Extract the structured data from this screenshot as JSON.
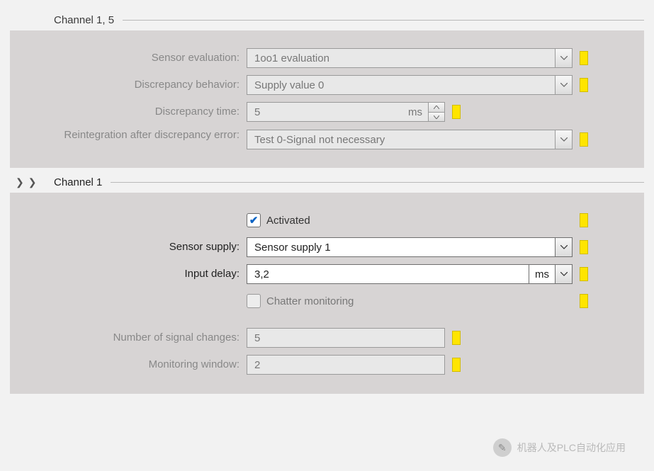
{
  "section1": {
    "title": "Channel 1, 5",
    "labels": {
      "sensor_eval": "Sensor evaluation:",
      "disc_behavior": "Discrepancy behavior:",
      "disc_time": "Discrepancy time:",
      "reint": "Reintegration after discrepancy error:"
    },
    "values": {
      "sensor_eval": "1oo1 evaluation",
      "disc_behavior": "Supply value 0",
      "disc_time": "5",
      "disc_time_unit": "ms",
      "reint": "Test 0-Signal not necessary"
    }
  },
  "section2": {
    "title": "Channel 1",
    "labels": {
      "activated": "Activated",
      "sensor_supply": "Sensor supply:",
      "input_delay": "Input delay:",
      "chatter": "Chatter monitoring",
      "signal_changes": "Number of signal changes:",
      "mon_window": "Monitoring window:"
    },
    "values": {
      "activated_checked": true,
      "sensor_supply": "Sensor supply 1",
      "input_delay": "3,2",
      "input_delay_unit": "ms",
      "chatter_checked": false,
      "signal_changes": "5",
      "mon_window": "2"
    }
  },
  "watermark": "机器人及PLC自动化应用"
}
